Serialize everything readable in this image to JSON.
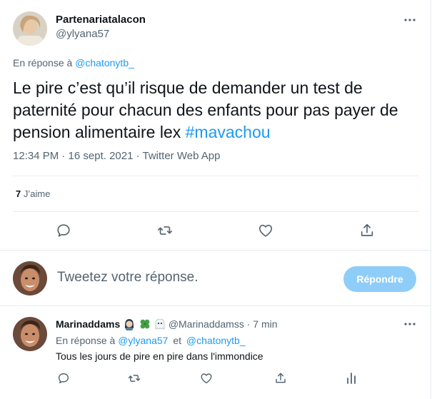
{
  "tweet": {
    "display_name": "Partenariatalacon",
    "handle": "@ylyana57",
    "reply_prefix": "En réponse à",
    "reply_to": "@chatonytb_",
    "text_main": "Le pire c’est qu’il risque de demander un test de paternité pour chacun des enfants pour pas payer de pension alimentaire lex",
    "hashtag": "#mavachou",
    "meta": "12:34 PM · 16 sept. 2021 · Twitter Web App",
    "likes_count": "7",
    "likes_label": "J’aime"
  },
  "compose": {
    "placeholder": "Tweetez votre réponse.",
    "reply_button": "Répondre"
  },
  "reply": {
    "display_name": "Marinaddams",
    "handle": "@Marinaddamss",
    "time": "· 7 min",
    "reply_prefix": "En réponse à",
    "reply_to_1": "@ylyana57",
    "conjunction": "et",
    "reply_to_2": "@chatonytb_",
    "text": "Tous les jours de pire en pire dans l'immondice"
  },
  "colors": {
    "accent": "#1d9bf0",
    "reply_button_bg": "#8ecdf8",
    "muted_text": "#536471",
    "divider": "#e6ecf0"
  },
  "icons": [
    "more-icon",
    "reply-icon",
    "retweet-icon",
    "like-icon",
    "share-icon",
    "analytics-icon",
    "clover-icon",
    "ghost-icon",
    "woman-emoji-icon"
  ]
}
